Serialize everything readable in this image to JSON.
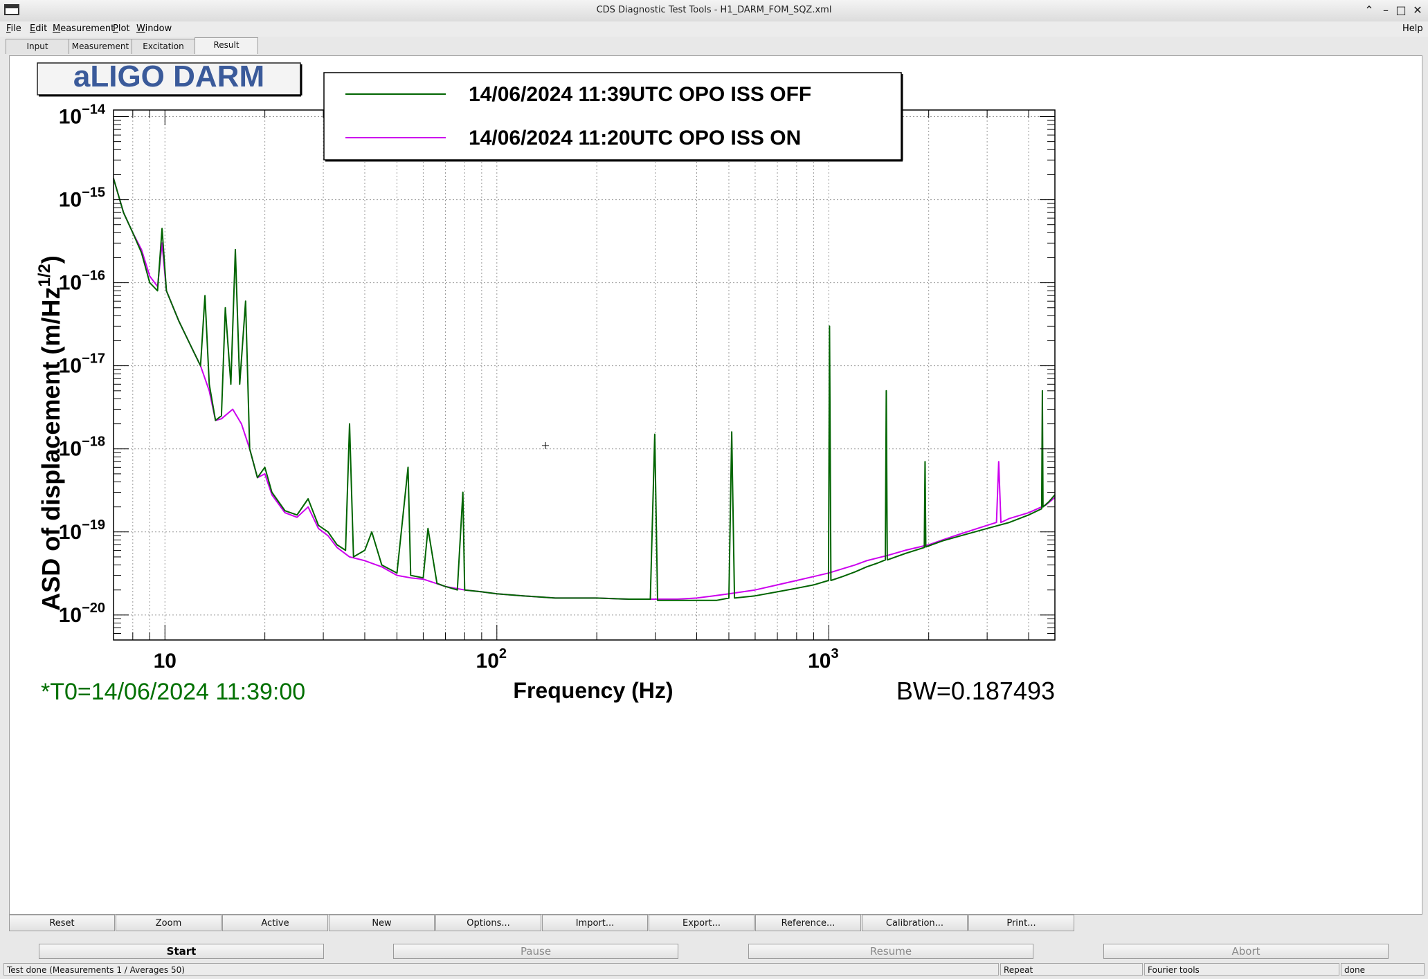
{
  "window": {
    "title": "CDS Diagnostic Test Tools - H1_DARM_FOM_SQZ.xml"
  },
  "menu": [
    {
      "label": "File",
      "u": "F",
      "rest": "ile"
    },
    {
      "label": "Edit",
      "u": "E",
      "rest": "dit"
    },
    {
      "label": "Measurement",
      "u": "M",
      "rest": "easurement"
    },
    {
      "label": "Plot",
      "u": "P",
      "rest": "lot"
    },
    {
      "label": "Window",
      "u": "W",
      "rest": "indow"
    }
  ],
  "help_label": "Help",
  "tabs": [
    "Input",
    "Measurement",
    "Excitation",
    "Result"
  ],
  "active_tab": "Result",
  "plot": {
    "title_box": "aLIGO DARM",
    "ylabel": "ASD of displacement (m/Hz",
    "ylabel_sup": "1/2",
    "ylabel_close": ")",
    "xlabel": "Frequency (Hz)",
    "t0": "*T0=14/06/2024 11:39:00",
    "bw": "BW=0.187493"
  },
  "chart_data": {
    "type": "line",
    "x_scale": "log",
    "y_scale": "log",
    "xlim": [
      7,
      4800
    ],
    "ylim": [
      5e-21,
      1.2e-14
    ],
    "x_ticks": [
      {
        "base": "10",
        "exp": ""
      },
      {
        "base": "10",
        "exp": "2"
      },
      {
        "base": "10",
        "exp": "3"
      }
    ],
    "y_ticks": [
      "-20",
      "-19",
      "-18",
      "-17",
      "-16",
      "-15",
      "-14"
    ],
    "grid": true,
    "legend_position": "top-center",
    "series": [
      {
        "name": "14/06/2024 11:39UTC OPO ISS OFF",
        "color": "#006400",
        "points": [
          [
            7,
            1.8e-15
          ],
          [
            7.5,
            7e-16
          ],
          [
            8,
            4e-16
          ],
          [
            8.5,
            2.3e-16
          ],
          [
            9,
            1e-16
          ],
          [
            9.5,
            8e-17
          ],
          [
            9.8,
            4.5e-16
          ],
          [
            10.1,
            8e-17
          ],
          [
            11,
            3.5e-17
          ],
          [
            12,
            1.7e-17
          ],
          [
            12.8,
            1e-17
          ],
          [
            13.2,
            7e-17
          ],
          [
            13.6,
            6e-18
          ],
          [
            14.2,
            2.2e-18
          ],
          [
            14.8,
            2.5e-18
          ],
          [
            15.2,
            5e-17
          ],
          [
            15.8,
            6e-18
          ],
          [
            16.3,
            2.5e-16
          ],
          [
            16.8,
            6e-18
          ],
          [
            17.5,
            6e-17
          ],
          [
            18,
            1e-18
          ],
          [
            19,
            4.5e-19
          ],
          [
            20,
            6e-19
          ],
          [
            21,
            3e-19
          ],
          [
            23,
            1.8e-19
          ],
          [
            25,
            1.6e-19
          ],
          [
            27,
            2.5e-19
          ],
          [
            29,
            1.2e-19
          ],
          [
            31,
            1e-19
          ],
          [
            33,
            7e-20
          ],
          [
            35,
            6e-20
          ],
          [
            36,
            2e-18
          ],
          [
            37,
            5e-20
          ],
          [
            40,
            6e-20
          ],
          [
            42,
            1e-19
          ],
          [
            45,
            4e-20
          ],
          [
            50,
            3.2e-20
          ],
          [
            54,
            6e-19
          ],
          [
            55,
            3e-20
          ],
          [
            60,
            2.8e-20
          ],
          [
            62,
            1.1e-19
          ],
          [
            66,
            2.4e-20
          ],
          [
            70,
            2.2e-20
          ],
          [
            76,
            2e-20
          ],
          [
            79,
            3e-19
          ],
          [
            80,
            2e-20
          ],
          [
            90,
            1.9e-20
          ],
          [
            100,
            1.8e-20
          ],
          [
            120,
            1.7e-20
          ],
          [
            150,
            1.6e-20
          ],
          [
            200,
            1.6e-20
          ],
          [
            250,
            1.55e-20
          ],
          [
            290,
            1.55e-20
          ],
          [
            299,
            1.5e-18
          ],
          [
            305,
            1.5e-20
          ],
          [
            350,
            1.5e-20
          ],
          [
            400,
            1.5e-20
          ],
          [
            460,
            1.5e-20
          ],
          [
            500,
            1.6e-20
          ],
          [
            510,
            1.6e-18
          ],
          [
            520,
            1.6e-20
          ],
          [
            600,
            1.7e-20
          ],
          [
            700,
            1.9e-20
          ],
          [
            800,
            2.1e-20
          ],
          [
            900,
            2.3e-20
          ],
          [
            998,
            2.6e-20
          ],
          [
            1005,
            3e-17
          ],
          [
            1015,
            2.6e-20
          ],
          [
            1100,
            2.9e-20
          ],
          [
            1200,
            3.3e-20
          ],
          [
            1300,
            3.8e-20
          ],
          [
            1400,
            4.2e-20
          ],
          [
            1480,
            4.6e-20
          ],
          [
            1490,
            5e-18
          ],
          [
            1500,
            4.6e-20
          ],
          [
            1700,
            5.5e-20
          ],
          [
            1940,
            6.5e-20
          ],
          [
            1950,
            7e-19
          ],
          [
            1960,
            6.6e-20
          ],
          [
            2200,
            7.8e-20
          ],
          [
            2500,
            9e-20
          ],
          [
            3000,
            1.1e-19
          ],
          [
            3500,
            1.3e-19
          ],
          [
            4000,
            1.6e-19
          ],
          [
            4380,
            1.9e-19
          ],
          [
            4400,
            5e-18
          ],
          [
            4420,
            2e-19
          ],
          [
            4600,
            2.3e-19
          ],
          [
            4800,
            2.8e-19
          ]
        ]
      },
      {
        "name": "14/06/2024 11:20UTC OPO ISS ON",
        "color": "#cc00ee",
        "points": [
          [
            7,
            1.8e-15
          ],
          [
            7.5,
            7e-16
          ],
          [
            8,
            4e-16
          ],
          [
            8.5,
            2.5e-16
          ],
          [
            9,
            1.2e-16
          ],
          [
            9.5,
            9e-17
          ],
          [
            9.8,
            3e-16
          ],
          [
            10.1,
            8e-17
          ],
          [
            11,
            3.5e-17
          ],
          [
            12,
            1.7e-17
          ],
          [
            12.8,
            1e-17
          ],
          [
            13.6,
            5e-18
          ],
          [
            14.2,
            2.2e-18
          ],
          [
            14.8,
            2.3e-18
          ],
          [
            16,
            3e-18
          ],
          [
            17,
            2e-18
          ],
          [
            18,
            1e-18
          ],
          [
            19,
            4.5e-19
          ],
          [
            20,
            5e-19
          ],
          [
            21,
            2.8e-19
          ],
          [
            23,
            1.7e-19
          ],
          [
            25,
            1.5e-19
          ],
          [
            27,
            2e-19
          ],
          [
            29,
            1.1e-19
          ],
          [
            31,
            9e-20
          ],
          [
            33,
            6.5e-20
          ],
          [
            36,
            5e-20
          ],
          [
            40,
            4.5e-20
          ],
          [
            45,
            3.8e-20
          ],
          [
            50,
            3e-20
          ],
          [
            55,
            2.8e-20
          ],
          [
            60,
            2.7e-20
          ],
          [
            70,
            2.2e-20
          ],
          [
            80,
            2e-20
          ],
          [
            90,
            1.9e-20
          ],
          [
            100,
            1.8e-20
          ],
          [
            120,
            1.7e-20
          ],
          [
            150,
            1.6e-20
          ],
          [
            200,
            1.6e-20
          ],
          [
            250,
            1.55e-20
          ],
          [
            300,
            1.55e-20
          ],
          [
            350,
            1.55e-20
          ],
          [
            400,
            1.6e-20
          ],
          [
            450,
            1.7e-20
          ],
          [
            500,
            1.8e-20
          ],
          [
            600,
            2e-20
          ],
          [
            700,
            2.3e-20
          ],
          [
            800,
            2.6e-20
          ],
          [
            900,
            2.9e-20
          ],
          [
            1000,
            3.2e-20
          ],
          [
            1100,
            3.6e-20
          ],
          [
            1200,
            4e-20
          ],
          [
            1300,
            4.5e-20
          ],
          [
            1500,
            5.2e-20
          ],
          [
            1700,
            6e-20
          ],
          [
            2000,
            7e-20
          ],
          [
            2200,
            8e-20
          ],
          [
            2500,
            9.5e-20
          ],
          [
            3000,
            1.2e-19
          ],
          [
            3200,
            1.3e-19
          ],
          [
            3250,
            7e-19
          ],
          [
            3300,
            1.3e-19
          ],
          [
            3500,
            1.45e-19
          ],
          [
            4000,
            1.7e-19
          ],
          [
            4500,
            2.1e-19
          ],
          [
            4800,
            2.6e-19
          ]
        ]
      }
    ]
  },
  "buttons_row1": [
    "Reset",
    "Zoom",
    "Active",
    "New",
    "Options...",
    "Import...",
    "Export...",
    "Reference...",
    "Calibration...",
    "Print..."
  ],
  "buttons_row2": [
    "Start",
    "Pause",
    "Resume",
    "Abort"
  ],
  "status": {
    "main": "Test done (Measurements 1 / Averages 50)",
    "repeat": "Repeat",
    "tools": "Fourier tools",
    "state": "done"
  },
  "colors": {
    "title_text": "#3a5a9a",
    "t0_text": "#007000",
    "trace_off": "#006400",
    "trace_on": "#cc00ee"
  }
}
